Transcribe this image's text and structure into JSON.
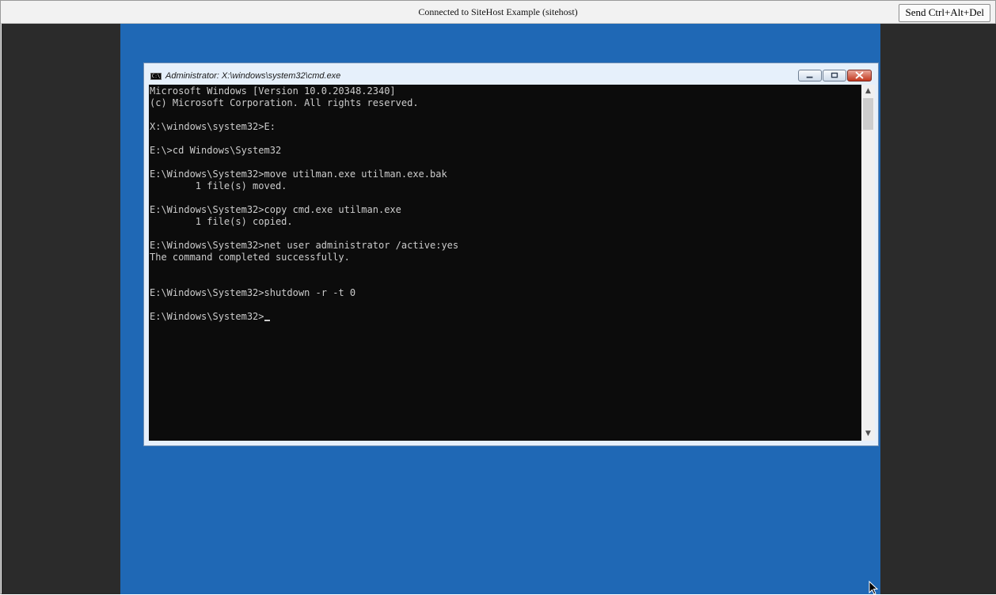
{
  "viewer": {
    "status": "Connected to SiteHost Example (sitehost)",
    "send_cad_label": "Send Ctrl+Alt+Del"
  },
  "cmd_window": {
    "title": "Administrator: X:\\windows\\system32\\cmd.exe",
    "icon_text": "C:\\",
    "console_lines": [
      "Microsoft Windows [Version 10.0.20348.2340]",
      "(c) Microsoft Corporation. All rights reserved.",
      "",
      "X:\\windows\\system32>E:",
      "",
      "E:\\>cd Windows\\System32",
      "",
      "E:\\Windows\\System32>move utilman.exe utilman.exe.bak",
      "        1 file(s) moved.",
      "",
      "E:\\Windows\\System32>copy cmd.exe utilman.exe",
      "        1 file(s) copied.",
      "",
      "E:\\Windows\\System32>net user administrator /active:yes",
      "The command completed successfully.",
      "",
      "",
      "E:\\Windows\\System32>shutdown -r -t 0",
      "",
      "E:\\Windows\\System32>"
    ]
  },
  "colors": {
    "desktop": "#1f68b5",
    "console_bg": "#0c0c0c",
    "console_text": "#cccccc",
    "letterbox": "#2b2b2b"
  },
  "icons": {
    "minimize": "minimize-icon",
    "maximize": "maximize-icon",
    "close": "close-icon",
    "scroll_up": "chevron-up-icon",
    "scroll_down": "chevron-down-icon",
    "pointer": "mouse-pointer-icon"
  }
}
